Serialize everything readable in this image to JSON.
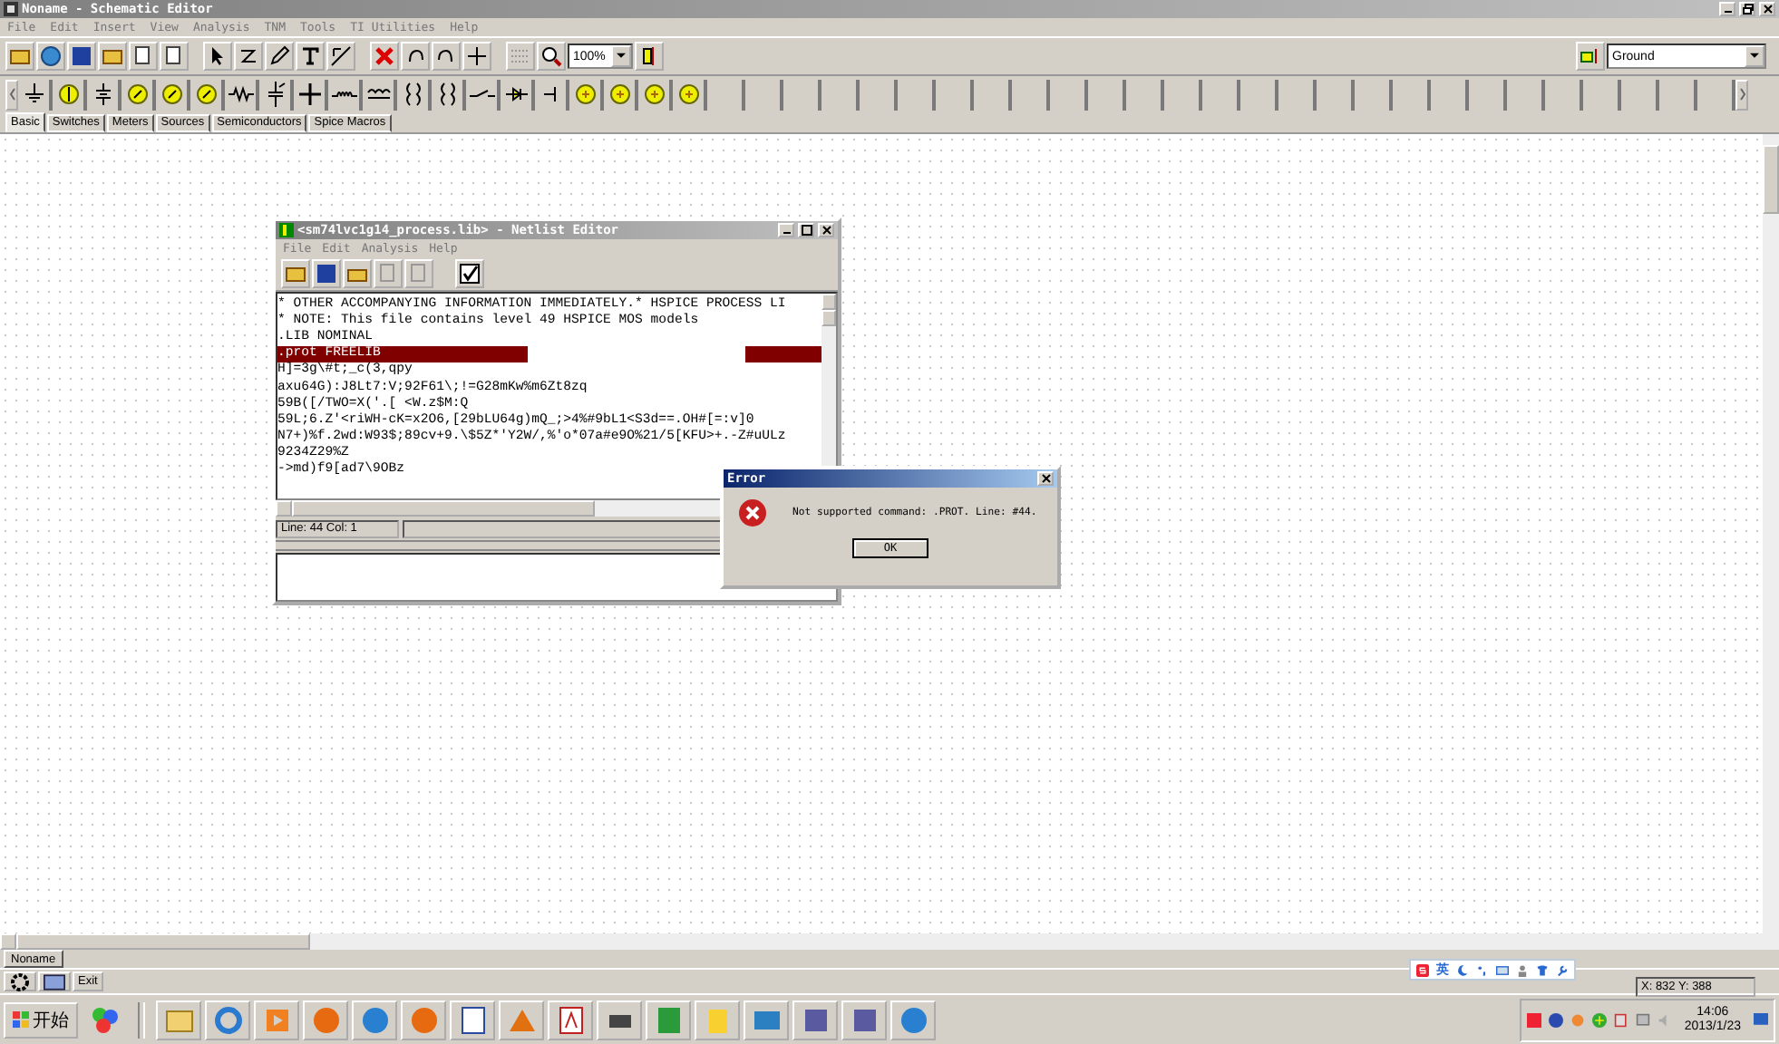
{
  "window": {
    "title": "Noname - Schematic Editor"
  },
  "menu": [
    "File",
    "Edit",
    "Insert",
    "View",
    "Analysis",
    "TNM",
    "Tools",
    "TI Utilities",
    "Help"
  ],
  "zoom": {
    "value": "100%"
  },
  "component_select": {
    "value": "Ground"
  },
  "palette_tabs": [
    {
      "label": "Basic",
      "selected": true
    },
    {
      "label": "Switches",
      "selected": false
    },
    {
      "label": "Meters",
      "selected": false
    },
    {
      "label": "Sources",
      "selected": false
    },
    {
      "label": "Semiconductors",
      "selected": false
    },
    {
      "label": "Spice Macros",
      "selected": false
    }
  ],
  "netlist_window": {
    "title": "<sm74lvc1g14_process.lib> - Netlist Editor",
    "menu": [
      "File",
      "Edit",
      "Analysis",
      "Help"
    ],
    "lines": [
      {
        "text": "* OTHER ACCOMPANYING INFORMATION IMMEDIATELY.* HSPICE PROCESS LI",
        "highlighted": false
      },
      {
        "text": "* NOTE: This file contains level 49 HSPICE MOS models",
        "highlighted": false
      },
      {
        "text": ".LIB NOMINAL",
        "highlighted": false
      },
      {
        "text": ".prot FREELIB",
        "highlighted": true
      },
      {
        "text": "H]=3g\\#t;_c(3,qpy",
        "highlighted": false
      },
      {
        "text": "axu64G):J8Lt7:V;92F61\\;!=G28mKw%m6Zt8zq",
        "highlighted": false
      },
      {
        "text": "59B([/TWO=X('.[ <W.z$M:Q",
        "highlighted": false
      },
      {
        "text": "59L;6.Z'<riWH-cK=x2O6,[29bLU64g)mQ_;>4%#9bL1<S3d==.OH#[=:v]0",
        "highlighted": false
      },
      {
        "text": "N7+)%f.2wd:W93$;89cv+9.\\$5Z*'Y2W/,%'o*07a#e9O%21/5[KFU>+.-Z#uULz",
        "highlighted": false
      },
      {
        "text": "9234Z29%Z",
        "highlighted": false
      },
      {
        "text": "->md)f9[ad7\\9OBz",
        "highlighted": false
      }
    ],
    "status": "Line: 44 Col: 1"
  },
  "error_dialog": {
    "title": "Error",
    "message": "Not supported command: .PROT. Line: #44.",
    "button": "OK"
  },
  "document_tab": {
    "label": "Noname"
  },
  "status_bar": {
    "exit_button": "Exit",
    "coordinates": "X: 832 Y: 388"
  },
  "ime_bar": {
    "language": "英"
  },
  "taskbar": {
    "start": "开始",
    "time": "14:06",
    "date": "2013/1/23"
  }
}
